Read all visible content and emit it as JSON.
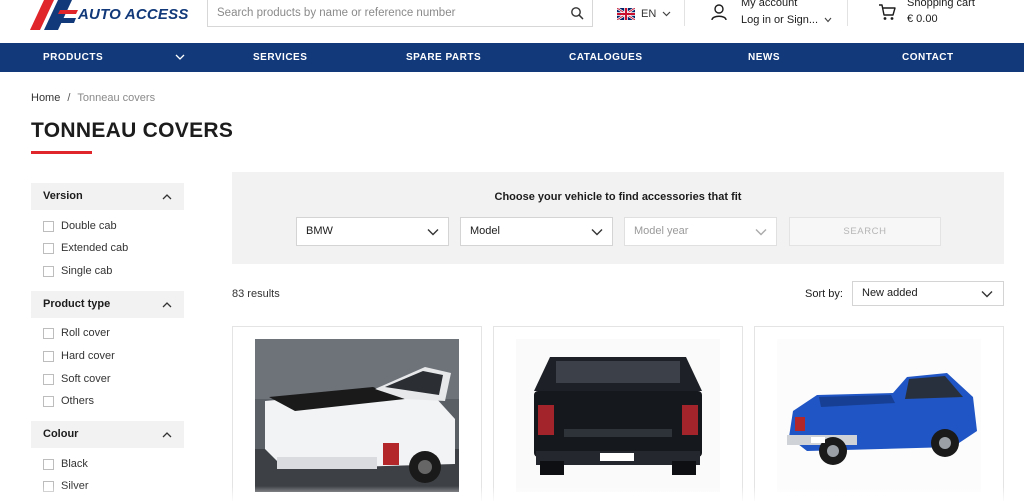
{
  "header": {
    "logo_letter": "A",
    "logo_text": "AUTO ACCESS",
    "search": {
      "placeholder": "Search products by name or reference number",
      "value": ""
    },
    "language": {
      "code": "EN",
      "flag_icon": "uk-flag-icon"
    },
    "account": {
      "title": "My account",
      "subtitle": "Log in or Sign...",
      "icon": "user-icon"
    },
    "cart": {
      "title": "Shopping cart",
      "total": "€ 0.00",
      "icon": "cart-icon"
    }
  },
  "nav": {
    "items": [
      {
        "label": "PRODUCTS",
        "has_dropdown": true
      },
      {
        "label": "SERVICES"
      },
      {
        "label": "SPARE PARTS"
      },
      {
        "label": "CATALOGUES"
      },
      {
        "label": "NEWS"
      },
      {
        "label": "CONTACT"
      }
    ]
  },
  "breadcrumb": {
    "home": "Home",
    "separator": "/",
    "current": "Tonneau covers"
  },
  "page": {
    "title": "TONNEAU COVERS"
  },
  "filters": [
    {
      "title": "Version",
      "options": [
        "Double cab",
        "Extended cab",
        "Single cab"
      ]
    },
    {
      "title": "Product type",
      "options": [
        "Roll cover",
        "Hard cover",
        "Soft cover",
        "Others"
      ]
    },
    {
      "title": "Colour",
      "options": [
        "Black",
        "Silver"
      ]
    }
  ],
  "finder": {
    "title": "Choose your vehicle to find accessories that fit",
    "brand": "BMW",
    "model": "Model",
    "model_year": "Model year",
    "search_label": "SEARCH"
  },
  "results": {
    "count": "83 results",
    "sort_label": "Sort by:",
    "sort_value": "New added"
  },
  "products": [
    {
      "image": "white-pickup-black-roll-cover"
    },
    {
      "image": "black-pickup-rear-view"
    },
    {
      "image": "blue-pickup-hard-cover"
    }
  ],
  "colors": {
    "brand_blue": "#123a7a",
    "accent_red": "#e0252b",
    "panel_grey": "#f2f2f2"
  }
}
